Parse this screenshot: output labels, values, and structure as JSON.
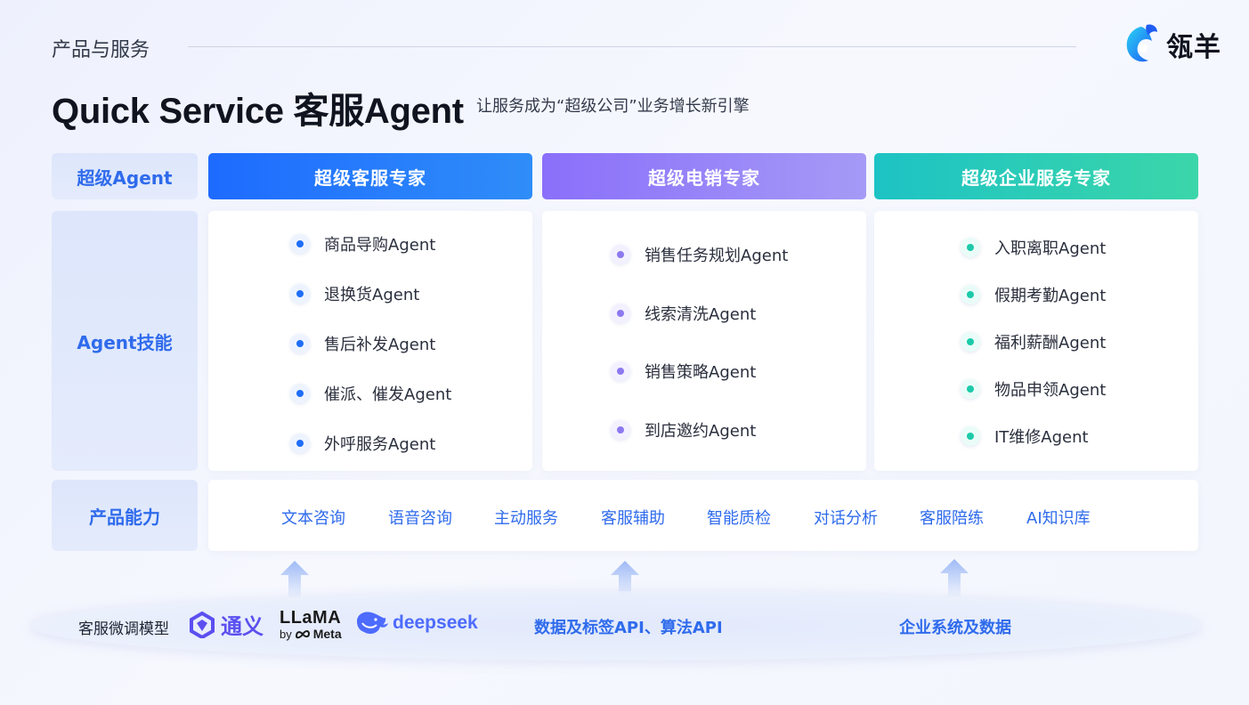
{
  "header": {
    "section_label": "产品与服务",
    "brand_name": "瓴羊",
    "title": "Quick Service 客服Agent",
    "subtitle": "让服务成为“超级公司”业务增长新引擎"
  },
  "row_labels": {
    "super_agent": "超级Agent",
    "agent_skills": "Agent技能",
    "product_capability": "产品能力"
  },
  "columns": [
    {
      "title": "超级客服专家",
      "accent": "#1e6bff",
      "items": [
        "商品导购Agent",
        "退换货Agent",
        "售后补发Agent",
        "催派、催发Agent",
        "外呼服务Agent"
      ]
    },
    {
      "title": "超级电销专家",
      "accent": "#8a6ffa",
      "items": [
        "销售任务规划Agent",
        "线索清洗Agent",
        "销售策略Agent",
        "到店邀约Agent"
      ]
    },
    {
      "title": "超级企业服务专家",
      "accent": "#1dc3c4",
      "items": [
        "入职离职Agent",
        "假期考勤Agent",
        "福利薪酬Agent",
        "物品申领Agent",
        "IT维修Agent"
      ]
    }
  ],
  "capabilities": [
    "文本咨询",
    "语音咨询",
    "主动服务",
    "客服辅助",
    "智能质检",
    "对话分析",
    "客服陪练",
    "AI知识库"
  ],
  "foundation": {
    "label": "客服微调模型",
    "models": {
      "tongyi": "通义",
      "llama": "LLaMA",
      "llama_by": "by",
      "llama_meta": "Meta",
      "deepseek": "deepseek"
    },
    "data_api": "数据及标签API、算法API",
    "enterprise_data": "企业系统及数据"
  }
}
